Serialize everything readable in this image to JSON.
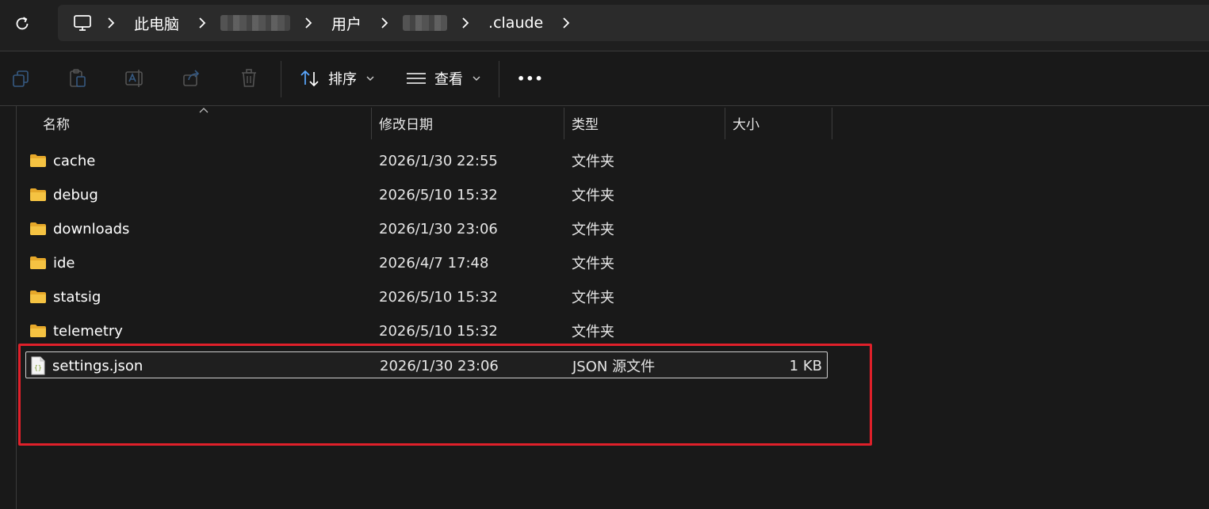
{
  "address": {
    "breadcrumbs": [
      {
        "label": "此电脑",
        "kind": "text"
      },
      {
        "label": "",
        "kind": "blurred"
      },
      {
        "label": "用户",
        "kind": "text"
      },
      {
        "label": "",
        "kind": "blurred"
      },
      {
        "label": ".claude",
        "kind": "text"
      }
    ]
  },
  "toolbar": {
    "sort_label": "排序",
    "view_label": "查看",
    "more_label": "•••"
  },
  "columns": {
    "name": "名称",
    "modified": "修改日期",
    "type": "类型",
    "size": "大小"
  },
  "files": [
    {
      "name": "cache",
      "modified": "2026/1/30 22:55",
      "type": "文件夹",
      "size": "",
      "icon": "folder-icon"
    },
    {
      "name": "debug",
      "modified": "2026/5/10 15:32",
      "type": "文件夹",
      "size": "",
      "icon": "folder-icon"
    },
    {
      "name": "downloads",
      "modified": "2026/1/30 23:06",
      "type": "文件夹",
      "size": "",
      "icon": "folder-icon"
    },
    {
      "name": "ide",
      "modified": "2026/4/7 17:48",
      "type": "文件夹",
      "size": "",
      "icon": "folder-icon"
    },
    {
      "name": "statsig",
      "modified": "2026/5/10 15:32",
      "type": "文件夹",
      "size": "",
      "icon": "folder-icon"
    },
    {
      "name": "telemetry",
      "modified": "2026/5/10 15:32",
      "type": "文件夹",
      "size": "",
      "icon": "folder-icon"
    },
    {
      "name": "settings.json",
      "modified": "2026/1/30 23:06",
      "type": "JSON 源文件",
      "size": "1 KB",
      "icon": "json-file-icon",
      "selected": true
    }
  ],
  "colors": {
    "background": "#191919",
    "address_bar": "#2b2b2b",
    "folder": "#f5c342",
    "annotation": "#e0202a"
  }
}
